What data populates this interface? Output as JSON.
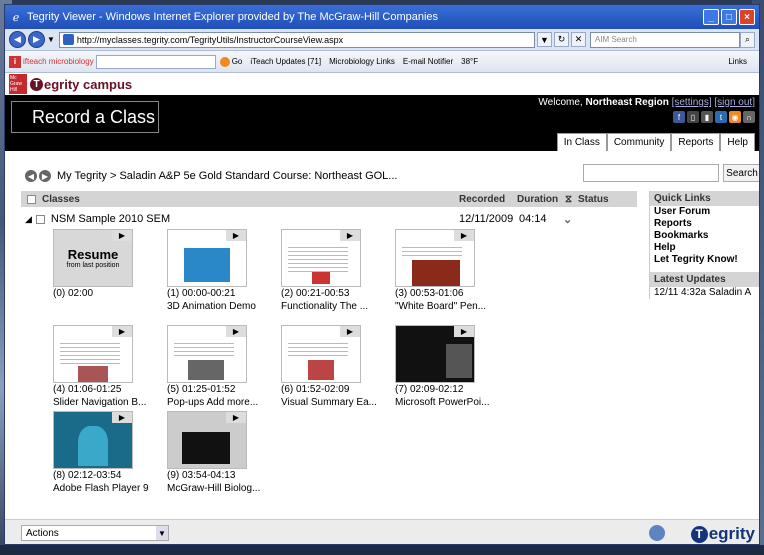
{
  "window": {
    "title": "Tegrity Viewer - Windows Internet Explorer provided by The McGraw-Hill Companies"
  },
  "address": {
    "url": "http://myclasses.tegrity.com/TegrityUtils/InstructorCourseView.aspx",
    "search_placeholder": "AIM Search"
  },
  "toolbar2": {
    "brand": "ifteach microbiology",
    "go": "Go",
    "updates": "iTeach Updates [71]",
    "micro": "Microbiology Links",
    "email": "E-mail Notifier",
    "weather": "38°F",
    "links": "Links"
  },
  "brand": {
    "mh": "Mc Graw Hill",
    "logo": "egrity campus"
  },
  "header": {
    "title": "Record a Class",
    "welcome_prefix": "Welcome, ",
    "user": "Northeast Region",
    "settings": "[settings]",
    "signout": "[sign out]",
    "tabs": [
      "In Class",
      "Community",
      "Reports",
      "Help"
    ]
  },
  "crumbs": {
    "text": "My Tegrity > Saladin A&P 5e Gold Standard Course: Northeast GOL..."
  },
  "search": {
    "button": "Search"
  },
  "table": {
    "classes": "Classes",
    "recorded": "Recorded",
    "duration": "Duration",
    "status": "Status"
  },
  "row": {
    "name": "NSM Sample 2010 SEM",
    "date": "12/11/2009",
    "duration": "04:14"
  },
  "resume": {
    "big": "Resume",
    "small": "from last position"
  },
  "thumbs": [
    {
      "line1": "(0) 02:00",
      "line2": ""
    },
    {
      "line1": "(1) 00:00-00:21",
      "line2": "3D Animation Demo"
    },
    {
      "line1": "(2) 00:21-00:53",
      "line2": "Functionality The ..."
    },
    {
      "line1": "(3) 00:53-01:06",
      "line2": "\"White Board\" Pen..."
    },
    {
      "line1": "(4) 01:06-01:25",
      "line2": "Slider Navigation B..."
    },
    {
      "line1": "(5) 01:25-01:52",
      "line2": "Pop-ups Add more..."
    },
    {
      "line1": "(6) 01:52-02:09",
      "line2": "Visual Summary Ea..."
    },
    {
      "line1": "(7) 02:09-02:12",
      "line2": "Microsoft PowerPoi..."
    },
    {
      "line1": "(8) 02:12-03:54",
      "line2": "Adobe Flash Player 9"
    },
    {
      "line1": "(9) 03:54-04:13",
      "line2": "McGraw-Hill Biolog..."
    }
  ],
  "quick": {
    "title": "Quick Links",
    "links": [
      "User Forum",
      "Reports",
      "Bookmarks",
      "Help",
      "Let Tegrity Know!"
    ],
    "updates_title": "Latest Updates",
    "update": "12/11 4:32a Saladin A"
  },
  "footer": {
    "actions": "Actions",
    "logo": "egrity"
  }
}
